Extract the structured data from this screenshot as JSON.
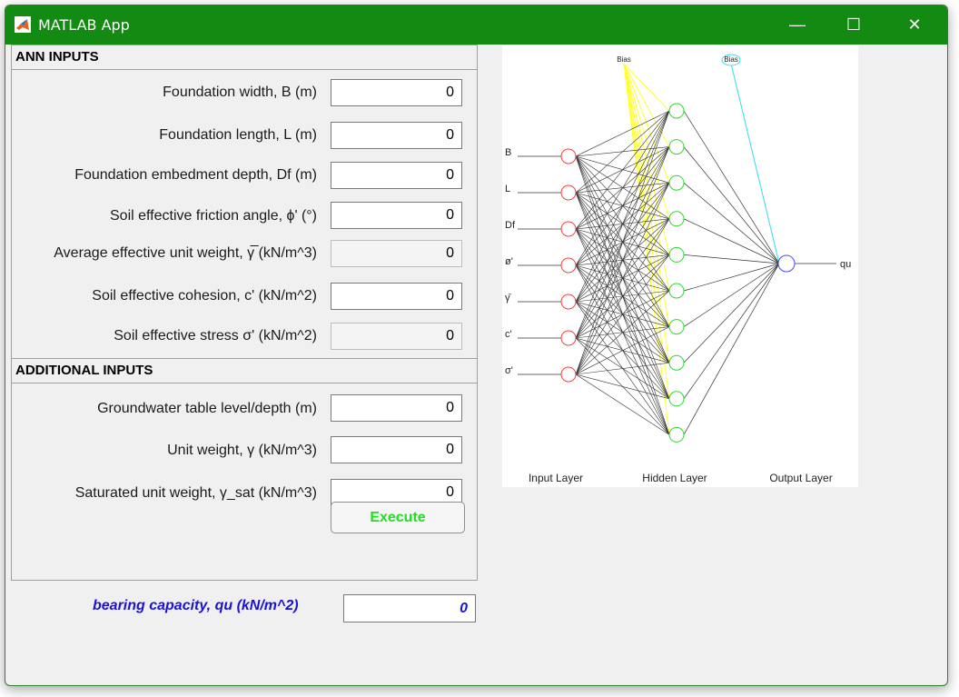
{
  "window": {
    "title": "MATLAB App",
    "minimize": "—",
    "maximize": "☐",
    "close": "✕"
  },
  "ann_panel": {
    "title": "ANN INPUTS",
    "fields": [
      {
        "label": "Foundation width, B (m)",
        "value": "0",
        "enabled": true
      },
      {
        "label": "Foundation length, L (m)",
        "value": "0",
        "enabled": true
      },
      {
        "label": "Foundation embedment depth, Df (m)",
        "value": "0",
        "enabled": true
      },
      {
        "label": "Soil effective friction angle, ϕ' (°)",
        "value": "0",
        "enabled": true
      },
      {
        "label": "Average effective unit weight, γ̅ (kN/m^3)",
        "value": "0",
        "enabled": false
      },
      {
        "label": "Soil effective cohesion, c' (kN/m^2)",
        "value": "0",
        "enabled": true
      },
      {
        "label": "Soil effective stress σ' (kN/m^2)",
        "value": "0",
        "enabled": false
      }
    ]
  },
  "additional_panel": {
    "title": "ADDITIONAL INPUTS",
    "fields": [
      {
        "label": "Groundwater table level/depth (m)",
        "value": "0",
        "enabled": true
      },
      {
        "label": "Unit weight, γ (kN/m^3)",
        "value": "0",
        "enabled": true
      },
      {
        "label": "Saturated unit weight, γ_sat (kN/m^3)",
        "value": "0",
        "enabled": true
      }
    ],
    "execute_label": "Execute"
  },
  "result": {
    "label": "bearing capacity, qu  (kN/m^2)",
    "value": "0"
  },
  "network_diagram": {
    "bias_label": "Bias",
    "input_nodes": [
      "B",
      "L",
      "Df",
      "ø'",
      "γ̄",
      "c'",
      "σ'"
    ],
    "hidden_count": 10,
    "output_label": "qu",
    "layer_labels": [
      "Input Layer",
      "Hidden Layer",
      "Output Layer"
    ],
    "colors": {
      "input": "#ff4040",
      "hidden": "#33d633",
      "output": "#4a4aff",
      "bias_hidden": "#ffff33",
      "bias_output": "#33ddee"
    }
  }
}
